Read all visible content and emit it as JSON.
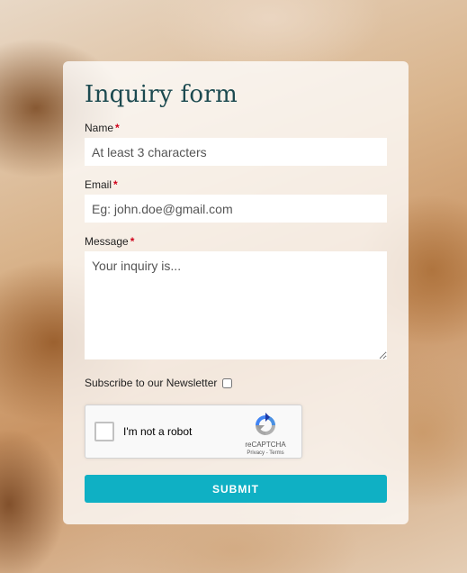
{
  "form": {
    "title": "Inquiry form",
    "name": {
      "label": "Name",
      "required_mark": "*",
      "placeholder": "At least 3 characters",
      "value": ""
    },
    "email": {
      "label": "Email",
      "required_mark": "*",
      "placeholder": "Eg: john.doe@gmail.com",
      "value": ""
    },
    "message": {
      "label": "Message",
      "required_mark": "*",
      "placeholder": "Your inquiry is...",
      "value": ""
    },
    "newsletter": {
      "label": "Subscribe to our Newsletter",
      "checked": false
    },
    "captcha": {
      "label": "I'm not a robot",
      "brand": "reCAPTCHA",
      "privacy": "Privacy",
      "separator": "-",
      "terms": "Terms",
      "checked": false
    },
    "submit_label": "SUBMIT"
  },
  "colors": {
    "accent": "#0fb0c4",
    "title": "#1c4a50",
    "required": "#d0021b"
  },
  "icons": {
    "captcha_logo": "recaptcha-logo-icon"
  }
}
